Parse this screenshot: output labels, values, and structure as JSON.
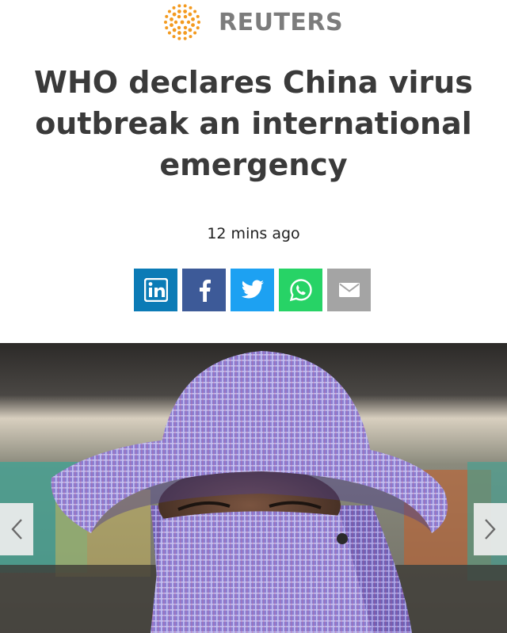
{
  "brand": {
    "name": "REUTERS",
    "logo_icon": "reuters-dot-logo-icon",
    "text_color": "#7c7c7c",
    "accent_color": "#f39a1f"
  },
  "article": {
    "headline_lines": [
      "WHO declares China virus",
      "outbreak an international",
      "emergency"
    ],
    "timestamp": "12 mins ago"
  },
  "share": {
    "buttons": [
      {
        "network": "linkedin",
        "icon": "linkedin-icon",
        "color": "#0b7bb6"
      },
      {
        "network": "facebook",
        "icon": "facebook-icon",
        "color": "#3d5a98"
      },
      {
        "network": "twitter",
        "icon": "twitter-icon",
        "color": "#1da1f2"
      },
      {
        "network": "whatsapp",
        "icon": "whatsapp-icon",
        "color": "#27d366"
      },
      {
        "network": "email",
        "icon": "email-icon",
        "color": "#a4a4a4"
      }
    ]
  },
  "gallery": {
    "prev_icon": "chevron-left-icon",
    "next_icon": "chevron-right-icon",
    "photo_subject": "person wearing checked purple hat and face covering"
  }
}
